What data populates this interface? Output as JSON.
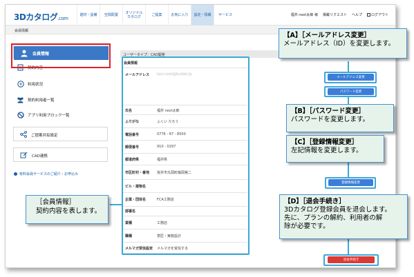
{
  "header": {
    "logo": "3Dカタログ",
    "logo_suffix": ".com",
    "nav": [
      {
        "label": "建材・設備",
        "active": false
      },
      {
        "label": "空間配置",
        "active": false
      },
      {
        "label": "オリジナル\nカタログ",
        "active": false
      },
      {
        "label": "ご提案",
        "active": false
      },
      {
        "label": "お気に入り",
        "active": false
      },
      {
        "label": "設定・情報",
        "active": true
      },
      {
        "label": "サービス",
        "active": false
      }
    ],
    "util": {
      "user": "福井 next太郎 様",
      "request": "掲載リクエスト",
      "help": "ヘルプ",
      "logout": "ログアウト"
    }
  },
  "breadcrumb": "会員情報",
  "sidebar": {
    "active_label": "会員情報",
    "items": [
      {
        "label": "契約内容",
        "icon": "contract-icon"
      },
      {
        "label": "利用状況",
        "icon": "yen-icon"
      },
      {
        "label": "契約利用者一覧",
        "icon": "users-icon"
      },
      {
        "label": "アプリ利用ブロック一覧",
        "icon": "block-icon"
      }
    ],
    "boxes": [
      {
        "label": "ご提案共有設定",
        "icon": "share-icon"
      },
      {
        "label": "CAD連携",
        "icon": "cad-icon"
      }
    ],
    "link": "有料会員サービスのご紹介・お申込み"
  },
  "main": {
    "user_type": "ユーザータイプ：CAD開発",
    "section_title": "会員情報",
    "rows": [
      {
        "key": "メールアドレス",
        "value": "taro.next@builder.jp",
        "blur": true
      },
      {
        "key": "氏名",
        "value": "福井 next太郎"
      },
      {
        "key": "ふりがな",
        "value": "ふくい たろう"
      },
      {
        "key": "電話番号",
        "value": "0776 - 67 - 8500"
      },
      {
        "key": "郵便番号",
        "value": "910 - 0297"
      },
      {
        "key": "都道府県",
        "value": "福井県"
      },
      {
        "key": "市区町村・番地",
        "value": "坂井市丸岡町篠岡第二"
      },
      {
        "key": "ビル・建物名",
        "value": ""
      },
      {
        "key": "企業・団体名",
        "value": "FCA工務店"
      },
      {
        "key": "部署名",
        "value": ""
      },
      {
        "key": "業種",
        "value": "工務店"
      },
      {
        "key": "職種",
        "value": "意匠・実施設計"
      },
      {
        "key": "メルマガ受信設定",
        "value": "メルマガを受信する"
      }
    ],
    "buttons": {
      "email_change": "メールアドレス変更",
      "password_change": "パスワード変更",
      "info_change": "登録情報変更",
      "withdraw": "退会手続き"
    }
  },
  "callouts": {
    "a_title": "【A】［メールアドレス変更］",
    "a_text": "メールアドレス（ID）を変更します。",
    "b_title": "【B】［パスワード変更］",
    "b_text": "パスワードを変更します。",
    "c_title": "【C】［登録情報変更］",
    "c_text": "左記情報を変更します。",
    "d_title": "【D】［退会手続き］",
    "d_text1": "3Dカタログ登録会員を退会します。",
    "d_text2": "先に、プランの解約、利用者の解",
    "d_text3": "除が必要です。",
    "info_title": "［会員情報］",
    "info_text": "契約内容を表します。"
  },
  "colors": {
    "accent": "#3b78c5",
    "danger": "#d93a35",
    "callout_bg": "#e6f3ea",
    "callout_border": "#4a8fcf",
    "ring": "#3ba7d9"
  }
}
